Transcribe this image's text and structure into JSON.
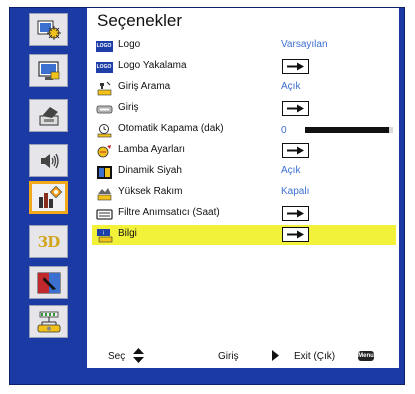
{
  "colors": {
    "frame_blue": "#1c3aa3",
    "value_blue": "#3d6fd0",
    "highlight_yellow": "#f2f23a",
    "active_orange": "#f2a81c"
  },
  "sidebar": {
    "items": [
      {
        "icon": "image-settings-icon",
        "active": false
      },
      {
        "icon": "display-screen-icon",
        "active": false
      },
      {
        "icon": "setup-hand-icon",
        "active": false
      },
      {
        "icon": "audio-speaker-icon",
        "active": false
      },
      {
        "icon": "options-settings-icon",
        "active": true
      },
      {
        "label": "3D",
        "icon": "3d-icon",
        "active": false
      },
      {
        "icon": "interactive-pen-icon",
        "active": false
      },
      {
        "icon": "network-lan-icon",
        "active": false
      }
    ]
  },
  "panel": {
    "title": "Seçenekler",
    "rows": [
      {
        "icon": "logo-icon",
        "logo_text": "LOGO",
        "label": "Logo",
        "value": "Varsayılan",
        "type": "value"
      },
      {
        "icon": "logo-capture-icon",
        "logo_text": "LOGO",
        "label": "Logo Yakalama",
        "type": "arrow"
      },
      {
        "icon": "input-search-icon",
        "label": "Giriş Arama",
        "value": "Açık",
        "type": "value"
      },
      {
        "icon": "input-icon",
        "label": "Giriş",
        "type": "arrow"
      },
      {
        "icon": "auto-power-off-icon",
        "label": "Otomatik Kapama (dak)",
        "value": "0",
        "slider_fraction": 0.95,
        "type": "slider"
      },
      {
        "icon": "lamp-settings-icon",
        "label": "Lamba Ayarları",
        "type": "arrow"
      },
      {
        "icon": "dynamic-black-icon",
        "label": "Dinamik Siyah",
        "value": "Açık",
        "type": "value"
      },
      {
        "icon": "high-altitude-icon",
        "label": "Yüksek Rakım",
        "value": "Kapalı",
        "type": "value"
      },
      {
        "icon": "filter-reminder-icon",
        "label": "Filtre Anımsatıcı (Saat)",
        "type": "arrow"
      },
      {
        "icon": "info-icon",
        "label": "Bilgi",
        "type": "arrow",
        "selected": true
      }
    ]
  },
  "footer": {
    "select_label": "Seç",
    "enter_label": "Giriş",
    "exit_label": "Exit (Çık)",
    "menu_badge": "Menu"
  }
}
